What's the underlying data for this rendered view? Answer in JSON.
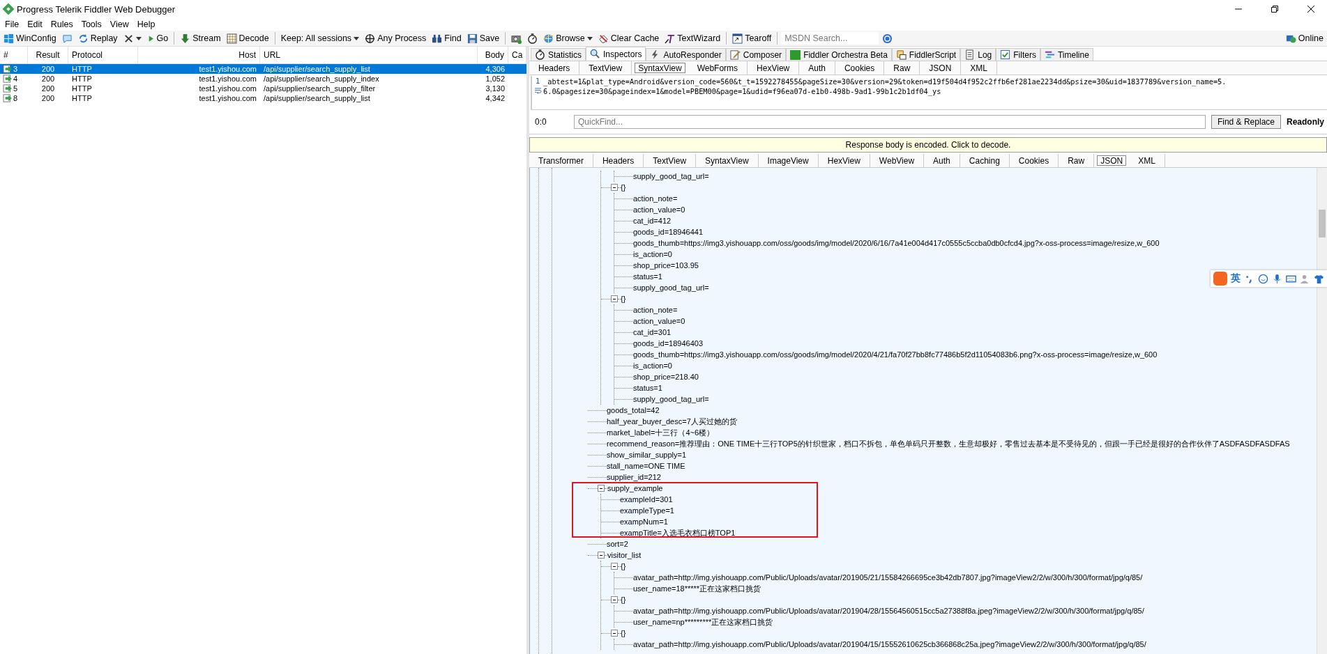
{
  "window": {
    "title": "Progress Telerik Fiddler Web Debugger"
  },
  "menu": [
    "File",
    "Edit",
    "Rules",
    "Tools",
    "View",
    "Help"
  ],
  "toolbar": {
    "items": [
      {
        "kind": "button",
        "label": "WinConfig",
        "dropdown": false
      },
      {
        "kind": "button",
        "dropdown": false
      },
      {
        "kind": "button",
        "label": "Replay",
        "dropdown": false
      },
      {
        "kind": "button",
        "dropdown": true
      },
      {
        "kind": "button",
        "label": "Go",
        "dropdown": false
      },
      {
        "kind": "separator"
      },
      {
        "kind": "button",
        "label": "Stream",
        "dropdown": false
      },
      {
        "kind": "button",
        "label": "Decode",
        "dropdown": false
      },
      {
        "kind": "separator"
      },
      {
        "kind": "button",
        "label": "Keep: All sessions",
        "dropdown": true
      },
      {
        "kind": "button",
        "label": "Any Process",
        "dropdown": false
      },
      {
        "kind": "button",
        "label": "Find",
        "dropdown": false
      },
      {
        "kind": "button",
        "label": "Save",
        "dropdown": false
      },
      {
        "kind": "separator"
      },
      {
        "kind": "button",
        "dropdown": false
      },
      {
        "kind": "button",
        "dropdown": false
      },
      {
        "kind": "button",
        "label": "Browse",
        "dropdown": true
      },
      {
        "kind": "button",
        "label": "Clear Cache",
        "dropdown": false
      },
      {
        "kind": "button",
        "label": "TextWizard",
        "dropdown": false
      },
      {
        "kind": "separator"
      },
      {
        "kind": "button",
        "label": "Tearoff",
        "dropdown": false
      },
      {
        "kind": "separator"
      },
      {
        "kind": "search",
        "placeholder": "MSDN Search..."
      },
      {
        "kind": "button",
        "dropdown": false
      }
    ],
    "online": "Online"
  },
  "sessions": {
    "columns": [
      "#",
      "Result",
      "Protocol",
      "Host",
      "URL",
      "Body",
      "Ca"
    ],
    "rows": [
      {
        "num": "3",
        "result": "200",
        "protocol": "HTTP",
        "host": "test1.yishou.com",
        "url": "/api/supplier/search_supply_list",
        "body": "4,306",
        "selected": true
      },
      {
        "num": "4",
        "result": "200",
        "protocol": "HTTP",
        "host": "test1.yishou.com",
        "url": "/api/supplier/search_supply_index",
        "body": "1,052",
        "selected": false
      },
      {
        "num": "5",
        "result": "200",
        "protocol": "HTTP",
        "host": "test1.yishou.com",
        "url": "/api/supplier/search_supply_filter",
        "body": "3,130",
        "selected": false
      },
      {
        "num": "8",
        "result": "200",
        "protocol": "HTTP",
        "host": "test1.yishou.com",
        "url": "/api/supplier/search_supply_list",
        "body": "4,342",
        "selected": false
      }
    ]
  },
  "main_tabs": [
    {
      "label": "Statistics",
      "selected": false
    },
    {
      "label": "Inspectors",
      "selected": true
    },
    {
      "label": "AutoResponder",
      "selected": false
    },
    {
      "label": "Composer",
      "selected": false
    },
    {
      "label": "Fiddler Orchestra Beta",
      "selected": false
    },
    {
      "label": "FiddlerScript",
      "selected": false
    },
    {
      "label": "Log",
      "selected": false
    },
    {
      "label": "Filters",
      "selected": false
    },
    {
      "label": "Timeline",
      "selected": false
    }
  ],
  "request": {
    "tabs": [
      {
        "label": "Headers",
        "selected": false
      },
      {
        "label": "TextView",
        "selected": false
      },
      {
        "label": "SyntaxView",
        "selected": true
      },
      {
        "label": "WebForms",
        "selected": false
      },
      {
        "label": "HexView",
        "selected": false
      },
      {
        "label": "Auth",
        "selected": false
      },
      {
        "label": "Cookies",
        "selected": false
      },
      {
        "label": "Raw",
        "selected": false
      },
      {
        "label": "JSON",
        "selected": false
      },
      {
        "label": "XML",
        "selected": false
      }
    ],
    "line_number": "1",
    "lines": [
      "_abtest=1&plat_type=Android&version_code=560&t_t=1592278455&pageSize=30&version=29&token=d19f504d4f952c2ffb6ef281ae2234dd&psize=30&uid=1837789&version_name=5.",
      "6.0&pagesize=30&pageindex=1&model=PBEM00&page=1&udid=f96ea07d-e1b0-498b-9ad1-99b1c2b1df04_ys"
    ],
    "position": "0:0",
    "quickfind": {
      "placeholder": "QuickFind..."
    },
    "find_button": "Find & Replace",
    "readonly": "Readonly"
  },
  "response": {
    "notice": "Response body is encoded. Click to decode.",
    "tabs": [
      {
        "label": "Transformer",
        "selected": false
      },
      {
        "label": "Headers",
        "selected": false
      },
      {
        "label": "TextView",
        "selected": false
      },
      {
        "label": "SyntaxView",
        "selected": false
      },
      {
        "label": "ImageView",
        "selected": false
      },
      {
        "label": "HexView",
        "selected": false
      },
      {
        "label": "WebView",
        "selected": false
      },
      {
        "label": "Auth",
        "selected": false
      },
      {
        "label": "Caching",
        "selected": false
      },
      {
        "label": "Cookies",
        "selected": false
      },
      {
        "label": "Raw",
        "selected": false
      },
      {
        "label": "JSON",
        "selected": true
      },
      {
        "label": "XML",
        "selected": false
      }
    ],
    "tree": [
      {
        "children": [
          {
            "children": [
              {
                "label": "supply_good_tag_url="
              }
            ]
          },
          {
            "label": "{}",
            "expanded": true,
            "children": [
              {
                "label": "action_note="
              },
              {
                "label": "action_value=0"
              },
              {
                "label": "cat_id=412"
              },
              {
                "label": "goods_id=18946441"
              },
              {
                "label": "goods_thumb=https://img3.yishouapp.com/oss/goods/img/model/2020/6/16/7a41e004d417c0555c5ccba0db0cfcd4.jpg?x-oss-process=image/resize,w_600"
              },
              {
                "label": "is_action=0"
              },
              {
                "label": "shop_price=103.95"
              },
              {
                "label": "status=1"
              },
              {
                "label": "supply_good_tag_url="
              }
            ]
          },
          {
            "label": "{}",
            "expanded": true,
            "children": [
              {
                "label": "action_note="
              },
              {
                "label": "action_value=0"
              },
              {
                "label": "cat_id=301"
              },
              {
                "label": "goods_id=18946403"
              },
              {
                "label": "goods_thumb=https://img3.yishouapp.com/oss/goods/img/model/2020/4/21/fa70f27bb8fc77486b5f2d11054083b6.png?x-oss-process=image/resize,w_600"
              },
              {
                "label": "is_action=0"
              },
              {
                "label": "shop_price=218.40"
              },
              {
                "label": "status=1"
              },
              {
                "label": "supply_good_tag_url="
              }
            ]
          }
        ]
      },
      {
        "label": "goods_total=42"
      },
      {
        "label": "half_year_buyer_desc=7人买过她的货"
      },
      {
        "label": "market_label=十三行（4~6楼）"
      },
      {
        "label": "recommend_reason=推荐理由：ONE TIME十三行TOP5的针织世家，档口不拆包，单色单码只开整数，生意却极好，零售过去基本是不受待见的，但跟一手已经是很好的合作伙伴了ASDFASDFASDFAS"
      },
      {
        "label": "show_similar_supply=1"
      },
      {
        "label": "stall_name=ONE TIME"
      },
      {
        "label": "supplier_id=212"
      },
      {
        "label": "supply_example",
        "expanded": true,
        "children": [
          {
            "label": "exampleId=301"
          },
          {
            "label": "exampleType=1"
          },
          {
            "label": "exampNum=1"
          },
          {
            "label": "exampTitle=入选毛衣档口榜TOP1"
          }
        ]
      },
      {
        "label": "sort=2"
      },
      {
        "label": "visitor_list",
        "expanded": true,
        "children": [
          {
            "label": "{}",
            "expanded": true,
            "children": [
              {
                "label": "avatar_path=http://img.yishouapp.com/Public/Uploads/avatar/201905/21/15584266695ce3b42db7807.jpg?imageView2/2/w/300/h/300/format/jpg/q/85/"
              },
              {
                "label": "user_name=18*****正在这家档口挑货"
              }
            ]
          },
          {
            "label": "{}",
            "expanded": true,
            "children": [
              {
                "label": "avatar_path=http://img.yishouapp.com/Public/Uploads/avatar/201904/28/15564560515cc5a27388f8a.jpeg?imageView2/2/w/300/h/300/format/jpg/q/85/"
              },
              {
                "label": "user_name=np*********正在这家档口挑货"
              }
            ]
          },
          {
            "label": "{}",
            "expanded": true,
            "children": [
              {
                "label": "avatar_path=http://img.yishouapp.com/Public/Uploads/avatar/201904/15/15552610625cb366868c25a.jpeg?imageView2/2/w/300/h/300/format/jpg/q/85/"
              }
            ]
          }
        ]
      }
    ]
  },
  "ime_bar": {
    "label": "英"
  }
}
